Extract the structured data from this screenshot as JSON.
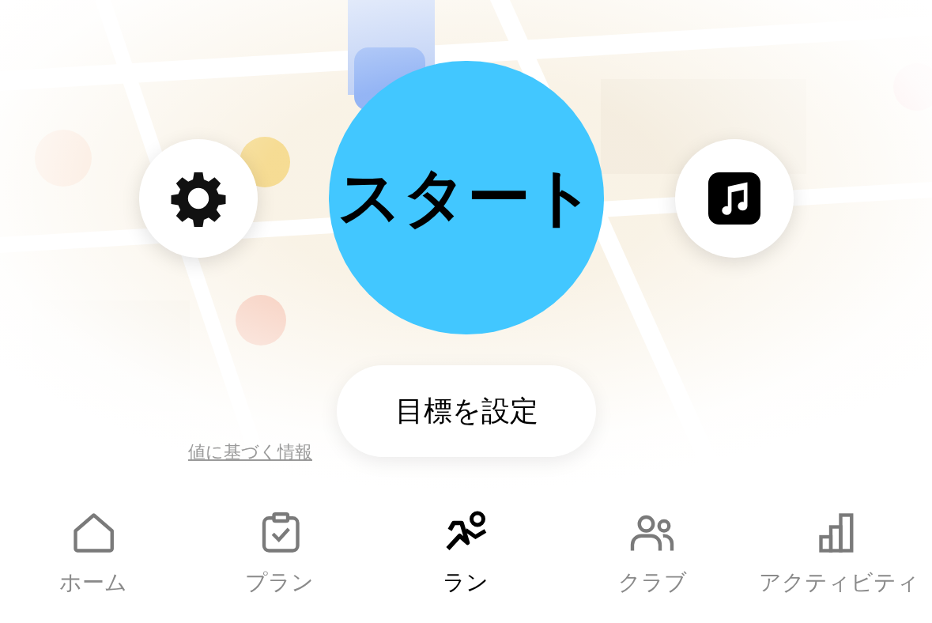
{
  "start_button": {
    "label": "スタート"
  },
  "goal_button": {
    "label": "目標を設定"
  },
  "map_link": {
    "text": "値に基づく情報"
  },
  "tabs": [
    {
      "label": "ホーム",
      "kind": "home",
      "selected": false
    },
    {
      "label": "プラン",
      "kind": "plan",
      "selected": false
    },
    {
      "label": "ラン",
      "kind": "run",
      "selected": true
    },
    {
      "label": "クラブ",
      "kind": "club",
      "selected": false
    },
    {
      "label": "アクティビティ",
      "kind": "activity",
      "selected": false
    }
  ]
}
